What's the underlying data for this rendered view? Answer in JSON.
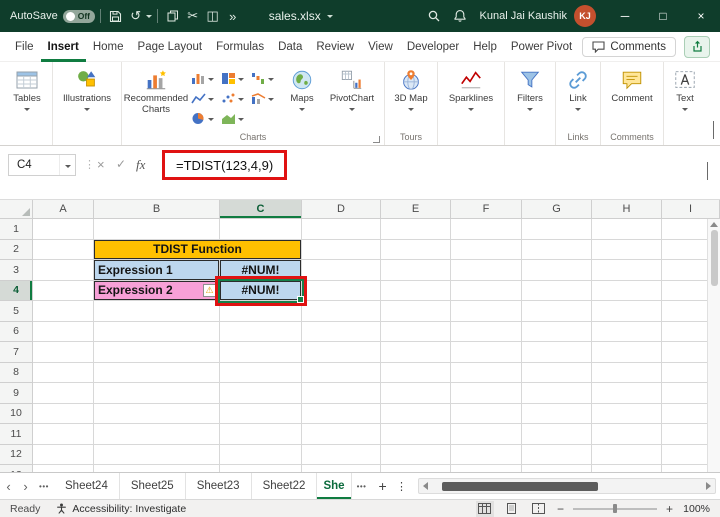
{
  "titlebar": {
    "autosave_label": "AutoSave",
    "autosave_state": "Off",
    "filename": "sales.xlsx",
    "user_name": "Kunal Jai Kaushik",
    "user_initials": "KJ"
  },
  "menubar": {
    "tabs": [
      "File",
      "Insert",
      "Home",
      "Page Layout",
      "Formulas",
      "Data",
      "Review",
      "View",
      "Developer",
      "Help",
      "Power Pivot"
    ],
    "active_tab": "Insert",
    "comments_button": "Comments"
  },
  "ribbon": {
    "tables_label": "Tables",
    "illustrations_label": "Illustrations",
    "recommended_label": "Recommended Charts",
    "maps_label": "Maps",
    "pivotchart_label": "PivotChart",
    "map3d_label": "3D Map",
    "sparklines_label": "Sparklines",
    "filters_label": "Filters",
    "link_label": "Link",
    "comment_label": "Comment",
    "text_label": "Text",
    "group_charts": "Charts",
    "group_tours": "Tours",
    "group_links": "Links",
    "group_comments": "Comments"
  },
  "formula_bar": {
    "name_box": "C4",
    "cancel": "×",
    "enter": "✓",
    "fx": "fx",
    "formula": "=TDIST(123,4,9)"
  },
  "grid": {
    "columns": [
      "A",
      "B",
      "C",
      "D",
      "E",
      "F",
      "G",
      "H",
      "I"
    ],
    "row_count": 13,
    "selected_column": "C",
    "selected_row": 4,
    "selected_cell": "C4",
    "cells": [
      {
        "col": "B",
        "row": 2,
        "colspan": 2,
        "text": "TDIST Function",
        "bg": "#ffc000",
        "align": "center",
        "bold": true,
        "boxed": true
      },
      {
        "col": "B",
        "row": 3,
        "text": "Expression 1",
        "bg": "#bdd7ee",
        "align": "left",
        "bold": true,
        "boxed": true
      },
      {
        "col": "C",
        "row": 3,
        "text": "#NUM!",
        "bg": "#bdd7ee",
        "align": "center",
        "bold": true,
        "boxed": true
      },
      {
        "col": "B",
        "row": 4,
        "text": "Expression 2",
        "bg": "#f7a0d7",
        "align": "left",
        "bold": true,
        "boxed": true,
        "warning": true
      },
      {
        "col": "C",
        "row": 4,
        "text": "#NUM!",
        "bg": "#bdd7ee",
        "align": "center",
        "bold": true,
        "boxed": true,
        "selected": true,
        "annotated": true
      }
    ]
  },
  "sheet_tabs": {
    "tabs": [
      "Sheet24",
      "Sheet25",
      "Sheet23",
      "Sheet22"
    ],
    "active_tab": "She",
    "add_label": "+"
  },
  "status_bar": {
    "mode": "Ready",
    "accessibility": "Accessibility: Investigate",
    "zoom": "100%"
  },
  "colors": {
    "accent_green": "#107c41",
    "titlebar_green": "#0f3d2b",
    "annotation_red": "#e01212",
    "banner_orange": "#ffc000",
    "blue_fill": "#bdd7ee",
    "pink_fill": "#f7a0d7",
    "avatar": "#c4502e"
  },
  "icons": {
    "undo": "↺",
    "cut": "✂",
    "picture": "◫",
    "more": "»",
    "minimize": "─",
    "maximize": "□",
    "close": "×",
    "warning": "⚠",
    "prev_sheet": "‹",
    "next_sheet": "›",
    "tabs_overflow": "•••",
    "kebab": "⋮",
    "zoom_out": "−",
    "zoom_in": "+"
  }
}
